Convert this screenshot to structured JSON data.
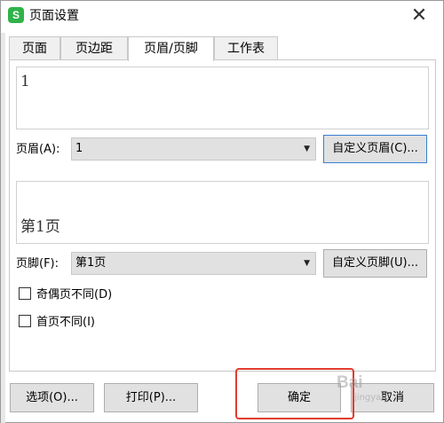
{
  "window": {
    "title": "页面设置",
    "app_icon_letter": "S",
    "close_glyph": "✕"
  },
  "tabs": [
    {
      "label": "页面"
    },
    {
      "label": "页边距"
    },
    {
      "label": "页眉/页脚",
      "active": true
    },
    {
      "label": "工作表"
    }
  ],
  "header": {
    "preview_text": "1",
    "label": "页眉(A):",
    "selected_value": "1",
    "custom_button": "自定义页眉(C)..."
  },
  "footer": {
    "preview_text": "第1页",
    "label": "页脚(F):",
    "selected_value": "第1页",
    "custom_button": "自定义页脚(U)..."
  },
  "options": {
    "odd_even_label": "奇偶页不同(D)",
    "odd_even_checked": false,
    "first_page_label": "首页不同(I)",
    "first_page_checked": false
  },
  "buttons": {
    "options": "选项(O)...",
    "print": "打印(P)...",
    "ok": "确定",
    "cancel": "取消"
  },
  "watermark": {
    "text": "Bai",
    "sub": "jingyan"
  },
  "colors": {
    "app_icon": "#2fb34a",
    "highlight": "#e23b2e",
    "focus_border": "#3c7fd0"
  }
}
